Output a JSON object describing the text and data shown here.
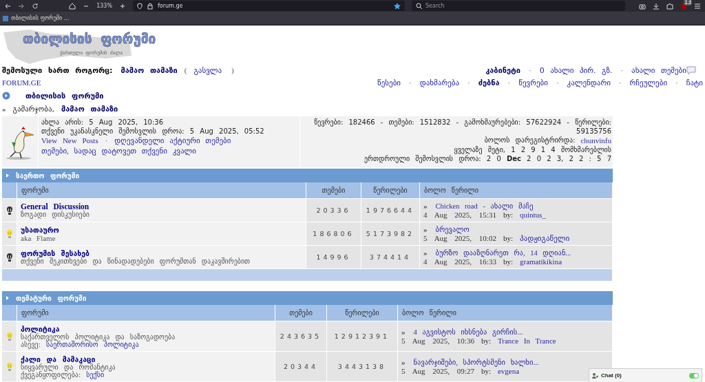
{
  "browser": {
    "zoom": "133%",
    "url": "forum.ge",
    "search_placeholder": "Search",
    "extension_badge": "13",
    "bookmark": "თბილისის ფორუმი ..."
  },
  "logo": {
    "title": "თბილისის ფორუმი",
    "tagline": "ქართული ფორუმის ძალა"
  },
  "user_bar": {
    "label": "შემოსული ხართ როგორც:",
    "username": "მამაო თამაზი",
    "paren_open": "(",
    "logout": "გასვლა",
    "paren_close": ")",
    "links": [
      {
        "text": "კაბინეტი",
        "bold": true
      },
      {
        "text": "0 ახალი პირ. გზ.",
        "bold": false,
        "prefix": "·"
      },
      {
        "text": "ახალი თემები",
        "bold": false,
        "prefix": "·"
      }
    ]
  },
  "nav": {
    "site": "FORUM.GE",
    "links": [
      {
        "text": "წესები",
        "bold": false
      },
      {
        "text": "დახმარება",
        "bold": false,
        "prefix": "·"
      },
      {
        "text": "ძებნა",
        "bold": true,
        "prefix": "·"
      },
      {
        "text": "წევრები",
        "bold": false,
        "prefix": "·"
      },
      {
        "text": "კალენდარი",
        "bold": false,
        "prefix": "·"
      },
      {
        "text": "რჩეულები",
        "bold": false,
        "prefix": "·"
      },
      {
        "text": "ჩატი",
        "bold": false,
        "prefix": "·"
      }
    ]
  },
  "breadcrumb": {
    "title": "თბილისის ფორუმი"
  },
  "greeting": {
    "marker": "»",
    "text": "გამარჯობა,",
    "username": "მამაო თამაზი"
  },
  "info": {
    "now": "ახლა არის: 5 Aug 2025, 10:36",
    "last_visit": "თქვენი უკანასკნელი შემოსვლის დროა: 5 Aug 2025, 05:52",
    "links": [
      {
        "text": "View New Posts"
      },
      {
        "text": "დღევანდელი აქტიური თემები",
        "prefix": "·"
      }
    ],
    "trail_link": "თემები, სადაც დატოვეთ თქვენი კვალი"
  },
  "stats": {
    "counts": [
      "წევრები: 182466 - თემები: 1512832 - გამოხმაურებები: 57622924 - წერილები:",
      "59135756"
    ],
    "newest_label": "ბოლოს დარეგისტრირდა:",
    "newest_user": "chunvinfu",
    "record": [
      "ყველაზე მეტი, 1 2 9 1 4 მომხმარებლის",
      "ერთდროული შემოსვლის დროა: 2 0 **Dec** 2 0 2 3, 2 2 : 5 7"
    ]
  },
  "categories": [
    {
      "title": "საერთო ფორუმი",
      "columns": [
        "ფორუმი",
        "თემები",
        "წერილები",
        "ბოლო წერილი"
      ],
      "forums": [
        {
          "name": "General Discussion",
          "description": "ზოგადი დისკუსიები",
          "new_posts": false,
          "topics": "20336",
          "posts": "1976644",
          "last_post": {
            "marker": "»",
            "title": "Chicken road - ახალი მაჩე",
            "date": "4 Aug 2025, 15:31",
            "by": "by:",
            "author": "quintus_"
          }
        },
        {
          "name": "უსათაურო",
          "description": "aka Flame",
          "new_posts": true,
          "topics": "186806",
          "posts": "5173982",
          "last_post": {
            "marker": "»",
            "title": "ბრევალო",
            "date": "5 Aug 2025, 10:02",
            "by": "by:",
            "author": "პადჟიგაწელი"
          }
        },
        {
          "name": "ფორუმის შესახებ",
          "description": "თქვენი შეკითხვები და წინადადებები ფორუმთან დაკავშირებით",
          "new_posts": false,
          "topics": "14996",
          "posts": "374414",
          "last_post": {
            "marker": "»",
            "title": "ბურზო დააზღნარეთ რა, 14 დღიან...",
            "date": "4 Aug 2025, 16:33",
            "by": "by:",
            "author": "gramatikikina"
          }
        }
      ]
    },
    {
      "title": "თემატური ფორუმი",
      "columns": [
        "ფორუმი",
        "თემები",
        "წერილები",
        "ბოლო წერილი"
      ],
      "forums": [
        {
          "name": "პოლიტიკა",
          "description": "საქართველოს პოლიტიკა და საზოგადოება",
          "subforums_label": "ასევე:",
          "subforums": "საერთაშორისო პოლიტიკა",
          "new_posts": true,
          "topics": "243635",
          "posts": "12912391",
          "last_post": {
            "marker": "»",
            "title": "4 აგვისტოს იხსნება გირჩის...",
            "date": "5 Aug 2025, 10:36",
            "by": "by:",
            "author": "Trance In Trance"
          }
        },
        {
          "name": "ქალი და მამაკაცი",
          "description": "სიყვარული და რომანტიკა",
          "subforums_label": "ქვეგანყოფილება:",
          "subforums": "სექსი",
          "new_posts": true,
          "topics": "20344",
          "posts": "3443138",
          "last_post": {
            "marker": "»",
            "title": "ნავარჯიშები, სპორტსმენი ხალხი...",
            "date": "5 Aug 2025, 09:27",
            "by": "by:",
            "author": "evgena"
          }
        }
      ]
    }
  ],
  "chat": {
    "label": "Chat (0)",
    "online": true
  }
}
